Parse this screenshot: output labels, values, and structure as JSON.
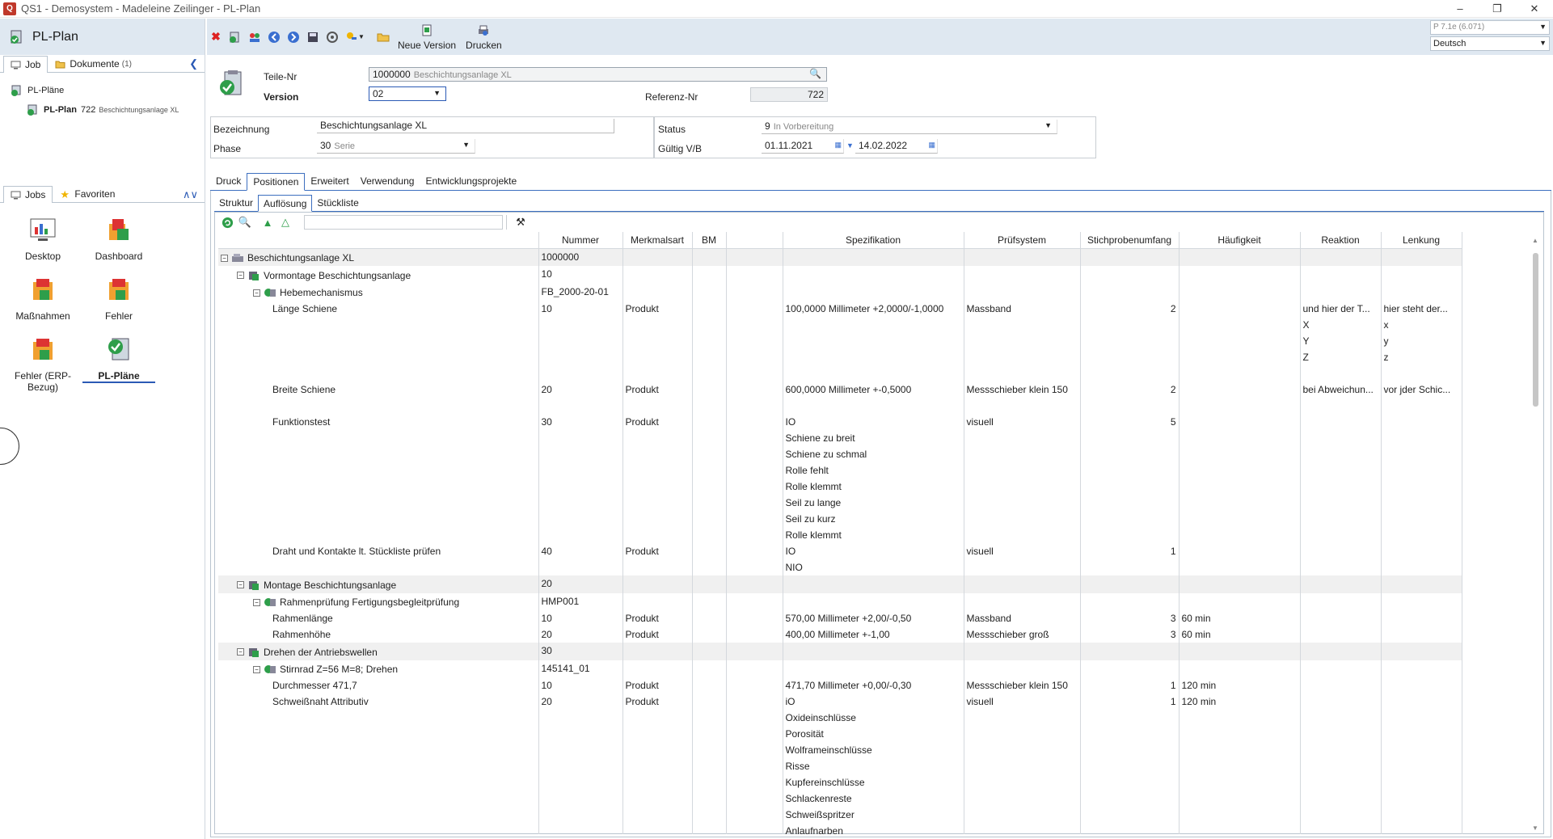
{
  "window": {
    "title": "QS1 - Demosystem - Madeleine Zeilinger - PL-Plan",
    "controls": [
      "–",
      "❐",
      "✕"
    ]
  },
  "left": {
    "header_title": "PL-Plan",
    "tab_job": "Job",
    "tab_docs": "Dokumente",
    "tab_docs_count": "(1)",
    "tree_root": "PL-Pläne",
    "tree_child_bold": "PL-Plan",
    "tree_child_num": "722",
    "tree_child_desc": "Beschichtungsanlage XL",
    "tab_jobs": "Jobs",
    "tab_favs": "Favoriten",
    "tiles": [
      {
        "label": "Desktop"
      },
      {
        "label": "Dashboard"
      },
      {
        "label": "Maßnahmen"
      },
      {
        "label": "Fehler"
      },
      {
        "label": "Fehler (ERP-Bezug)"
      },
      {
        "label": "PL-Pläne"
      }
    ]
  },
  "toolbar": {
    "new_version": "Neue Version",
    "print": "Drucken",
    "version_info": "P 7.1e (6.071)",
    "language": "Deutsch"
  },
  "header": {
    "teile_nr_label": "Teile-Nr",
    "teile_nr_value": "1000000",
    "teile_nr_desc": "Beschichtungsanlage XL",
    "version_label": "Version",
    "version_value": "02",
    "referenz_label": "Referenz-Nr",
    "referenz_value": "722",
    "bezeichnung_label": "Bezeichnung",
    "bezeichnung_value": "Beschichtungsanlage XL",
    "phase_label": "Phase",
    "phase_value": "30",
    "phase_desc": "Serie",
    "status_label": "Status",
    "status_value": "9",
    "status_desc": "In Vorbereitung",
    "gueltig_label": "Gültig V/B",
    "gueltig_von": "01.11.2021",
    "gueltig_bis": "14.02.2022"
  },
  "tabs": [
    "Druck",
    "Positionen",
    "Erweitert",
    "Verwendung",
    "Entwicklungsprojekte"
  ],
  "subtabs": [
    "Struktur",
    "Auflösung",
    "Stückliste"
  ],
  "grid": {
    "columns": [
      "",
      "Nummer",
      "Merkmalsart",
      "BM",
      "",
      "Spezifikation",
      "Prüfsystem",
      "Stichprobenumfang",
      "Häufigkeit",
      "Reaktion",
      "Lenkung"
    ],
    "rows": [
      {
        "level": 0,
        "group": true,
        "name": "Beschichtungsanlage XL",
        "nummer": "1000000",
        "art": "",
        "spec": [],
        "pruef": "",
        "stich": "",
        "haeuf": "",
        "reak": [],
        "lenk": []
      },
      {
        "level": 1,
        "group": false,
        "name": "Vormontage Beschichtungsanlage",
        "nummer": "10",
        "art": "",
        "spec": [],
        "pruef": "",
        "stich": "",
        "haeuf": "",
        "reak": [],
        "lenk": []
      },
      {
        "level": 2,
        "group": false,
        "name": "Hebemechanismus",
        "nummer": "FB_2000-20-01",
        "art": "",
        "spec": [],
        "pruef": "",
        "stich": "",
        "haeuf": "",
        "reak": [],
        "lenk": []
      },
      {
        "level": 3,
        "group": false,
        "name": "Länge Schiene",
        "nummer": "10",
        "art": "Produkt",
        "spec": [
          "100,0000 Millimeter +2,0000/-1,0000"
        ],
        "pruef": "Massband",
        "stich": "2",
        "haeuf": "",
        "reak": [
          "und hier der T...",
          "X",
          "Y",
          "Z"
        ],
        "lenk": [
          "hier steht der...",
          "x",
          "y",
          "z"
        ],
        "lines": 5
      },
      {
        "level": 3,
        "group": false,
        "name": "Breite Schiene",
        "nummer": "20",
        "art": "Produkt",
        "spec": [
          "600,0000 Millimeter +-0,5000"
        ],
        "pruef": "Messschieber klein 150",
        "stich": "2",
        "haeuf": "",
        "reak": [
          "bei Abweichun..."
        ],
        "lenk": [
          "vor jder Schic..."
        ],
        "lines": 2
      },
      {
        "level": 3,
        "group": false,
        "name": "Funktionstest",
        "nummer": "30",
        "art": "Produkt",
        "spec": [
          "IO",
          "Schiene zu breit",
          "Schiene zu schmal",
          "Rolle fehlt",
          "Rolle klemmt",
          "Seil zu lange",
          "Seil zu kurz",
          "Rolle klemmt"
        ],
        "pruef": "visuell",
        "stich": "5",
        "haeuf": "",
        "reak": [],
        "lenk": [],
        "lines": 8
      },
      {
        "level": 3,
        "group": false,
        "name": "Draht und Kontakte lt. Stückliste prüfen",
        "nummer": "40",
        "art": "Produkt",
        "spec": [
          "IO",
          "NIO"
        ],
        "pruef": "visuell",
        "stich": "1",
        "haeuf": "",
        "reak": [],
        "lenk": [],
        "lines": 2
      },
      {
        "level": 1,
        "group": true,
        "name": "Montage Beschichtungsanlage",
        "nummer": "20",
        "art": "",
        "spec": [],
        "pruef": "",
        "stich": "",
        "haeuf": "",
        "reak": [],
        "lenk": []
      },
      {
        "level": 2,
        "group": false,
        "name": "Rahmenprüfung Fertigungsbegleitprüfung",
        "nummer": "HMP001",
        "art": "",
        "spec": [],
        "pruef": "",
        "stich": "",
        "haeuf": "",
        "reak": [],
        "lenk": []
      },
      {
        "level": 3,
        "group": false,
        "name": "Rahmenlänge",
        "nummer": "10",
        "art": "Produkt",
        "spec": [
          "570,00 Millimeter +2,00/-0,50"
        ],
        "pruef": "Massband",
        "stich": "3",
        "haeuf": "60 min",
        "reak": [],
        "lenk": []
      },
      {
        "level": 3,
        "group": false,
        "name": "Rahmenhöhe",
        "nummer": "20",
        "art": "Produkt",
        "spec": [
          "400,00 Millimeter +-1,00"
        ],
        "pruef": "Messschieber groß",
        "stich": "3",
        "haeuf": "60 min",
        "reak": [],
        "lenk": []
      },
      {
        "level": 1,
        "group": true,
        "name": "Drehen der Antriebswellen",
        "nummer": "30",
        "art": "",
        "spec": [],
        "pruef": "",
        "stich": "",
        "haeuf": "",
        "reak": [],
        "lenk": []
      },
      {
        "level": 2,
        "group": false,
        "name": "Stirnrad Z=56 M=8; Drehen",
        "nummer": "145141_01",
        "art": "",
        "spec": [],
        "pruef": "",
        "stich": "",
        "haeuf": "",
        "reak": [],
        "lenk": []
      },
      {
        "level": 3,
        "group": false,
        "name": "Durchmesser 471,7",
        "nummer": "10",
        "art": "Produkt",
        "spec": [
          "471,70 Millimeter +0,00/-0,30"
        ],
        "pruef": "Messschieber klein 150",
        "stich": "1",
        "haeuf": "120 min",
        "reak": [],
        "lenk": []
      },
      {
        "level": 3,
        "group": false,
        "name": "Schweißnaht Attributiv",
        "nummer": "20",
        "art": "Produkt",
        "spec": [
          "iO",
          "Oxideinschlüsse",
          "Porosität",
          "Wolframeinschlüsse",
          "Risse",
          "Kupfereinschlüsse",
          "Schlackenreste",
          "Schweißspritzer",
          "Anlaufnarben"
        ],
        "pruef": "visuell",
        "stich": "1",
        "haeuf": "120 min",
        "reak": [],
        "lenk": []
      }
    ]
  }
}
